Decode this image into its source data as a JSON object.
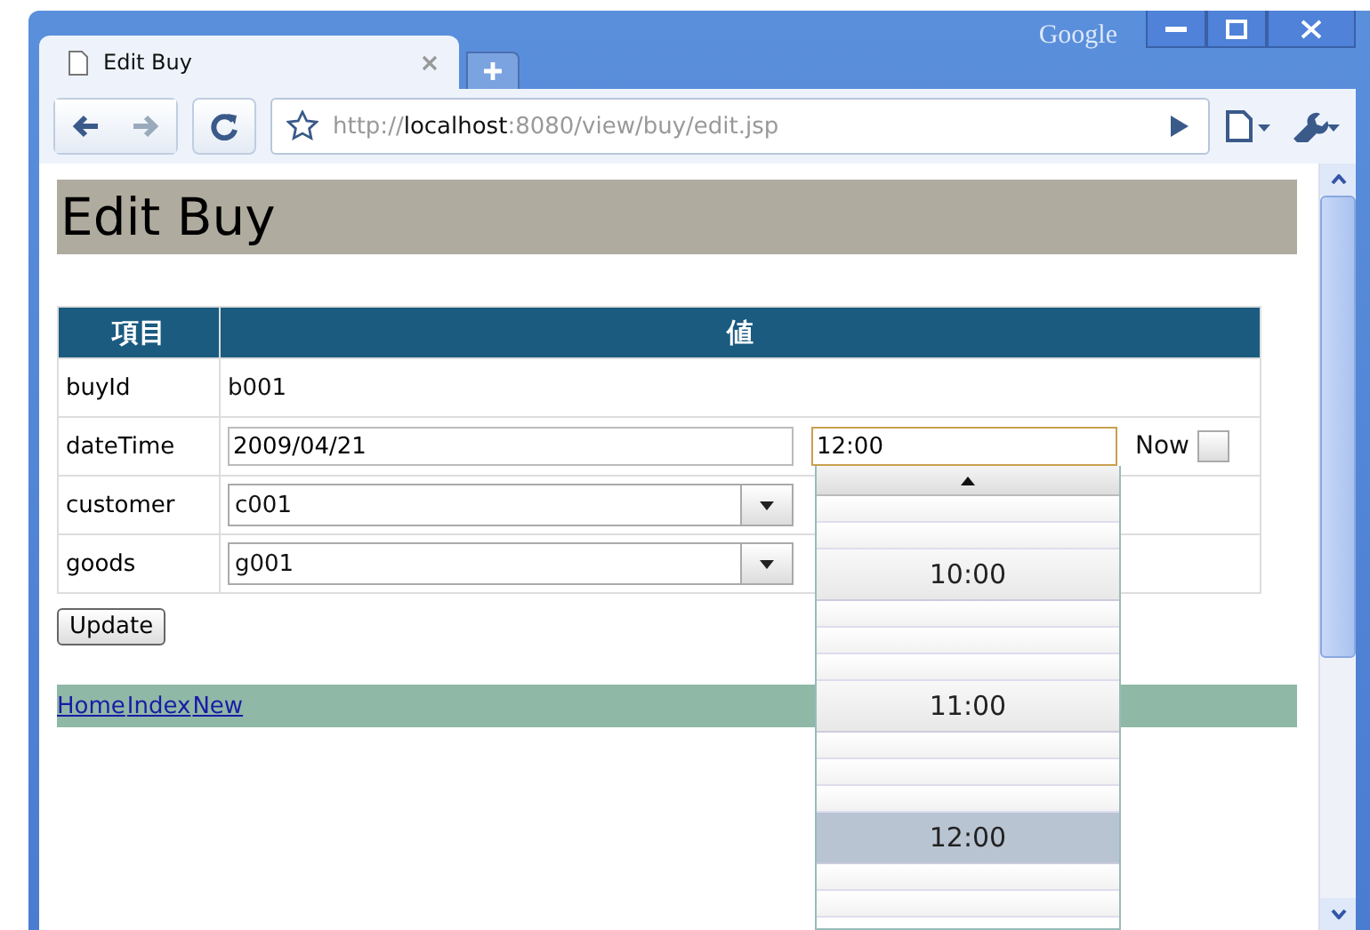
{
  "window": {
    "brand": "Google"
  },
  "tabs": [
    {
      "title": "Edit Buy",
      "selected": true
    }
  ],
  "address": {
    "scheme": "http://",
    "host": "localhost",
    "rest": ":8080/view/buy/edit.jsp"
  },
  "page": {
    "heading": "Edit Buy",
    "table": {
      "columns": [
        "項目",
        "値"
      ],
      "rows": [
        {
          "kind": "text",
          "label": "buyId",
          "value": "b001"
        },
        {
          "kind": "datetime",
          "label": "dateTime",
          "value": "2009/04/21",
          "time": "12:00",
          "now_label": "Now",
          "now_checked": false
        },
        {
          "kind": "select",
          "label": "customer",
          "value": "c001"
        },
        {
          "kind": "select",
          "label": "goods",
          "value": "g001"
        }
      ]
    },
    "button": "Update",
    "links": [
      "Home",
      "Index",
      "New"
    ],
    "time_list": [
      {
        "kind": "minor",
        "selected": false
      },
      {
        "kind": "minor",
        "selected": false
      },
      {
        "kind": "major",
        "label": "10:00",
        "selected": false
      },
      {
        "kind": "minor",
        "selected": false
      },
      {
        "kind": "minor",
        "selected": false
      },
      {
        "kind": "minor",
        "selected": false
      },
      {
        "kind": "major",
        "label": "11:00",
        "selected": false
      },
      {
        "kind": "minor",
        "selected": false
      },
      {
        "kind": "minor",
        "selected": false
      },
      {
        "kind": "minor",
        "selected": false
      },
      {
        "kind": "major",
        "label": "12:00",
        "selected": true
      },
      {
        "kind": "minor",
        "selected": false
      },
      {
        "kind": "minor",
        "selected": false
      }
    ]
  }
}
